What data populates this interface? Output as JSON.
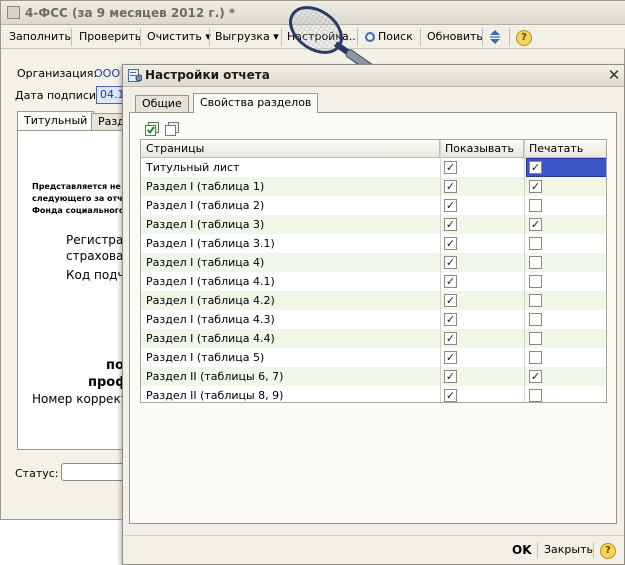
{
  "window": {
    "title": "4-ФСС (за 9 месяцев 2012 г.) *"
  },
  "toolbar": {
    "items": [
      "Заполнить",
      "Проверить",
      "Очистить",
      "Выгрузка",
      "Настройка...",
      "Поиск",
      "Обновить"
    ]
  },
  "form": {
    "org_label": "Организация:",
    "org_value": "ООО",
    "date_label": "Дата подписи:",
    "date_value": "04.1",
    "tabs": [
      "Титульный",
      "Разд"
    ],
    "status_label": "Статус:"
  },
  "doc": {
    "line1": "Представляется не п",
    "line2": "следующего за отчет",
    "line3": "Фонда социального с",
    "reg1": "Регистра",
    "reg2": "страховат",
    "code": "Код подчи",
    "b1": "по",
    "b2": "проф",
    "corr": "Номер корректи"
  },
  "dialog": {
    "title": "Настройки отчета",
    "tabs": [
      "Общие",
      "Свойства разделов"
    ],
    "columns": [
      "Страницы",
      "Показывать",
      "Печатать"
    ],
    "rows": [
      {
        "name": "Титульный лист",
        "show": true,
        "print": true
      },
      {
        "name": "Раздел I (таблица 1)",
        "show": true,
        "print": true
      },
      {
        "name": "Раздел I (таблица 2)",
        "show": true,
        "print": false
      },
      {
        "name": "Раздел I (таблица 3)",
        "show": true,
        "print": true
      },
      {
        "name": "Раздел I (таблица 3.1)",
        "show": true,
        "print": false
      },
      {
        "name": "Раздел I (таблица 4)",
        "show": true,
        "print": false
      },
      {
        "name": "Раздел I (таблица 4.1)",
        "show": true,
        "print": false
      },
      {
        "name": "Раздел I (таблица 4.2)",
        "show": true,
        "print": false
      },
      {
        "name": "Раздел I (таблица 4.3)",
        "show": true,
        "print": false
      },
      {
        "name": "Раздел I (таблица 4.4)",
        "show": true,
        "print": false
      },
      {
        "name": "Раздел I (таблица 5)",
        "show": true,
        "print": false
      },
      {
        "name": "Раздел II (таблицы 6, 7)",
        "show": true,
        "print": true
      },
      {
        "name": "Раздел II (таблицы 8, 9)",
        "show": true,
        "print": false
      }
    ],
    "ok_label": "OK",
    "close_label": "Закрыть"
  },
  "colors": {
    "selection": "#3a56c6",
    "row_alt": "#f0f7e8"
  }
}
